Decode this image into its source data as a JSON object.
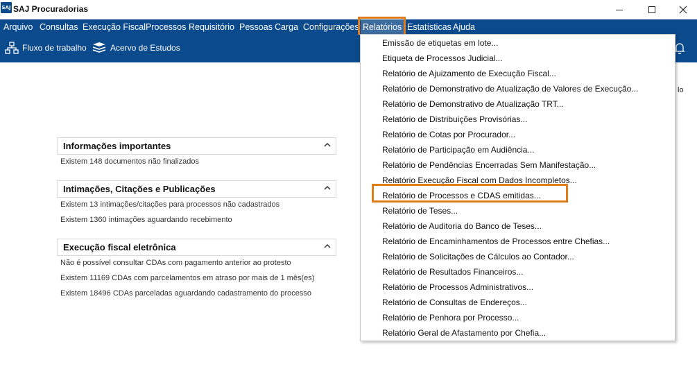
{
  "window": {
    "logo_text": "SAJ",
    "title": "SAJ Procuradorias"
  },
  "menubar": {
    "items": [
      "Arquivo",
      "Consultas",
      "Execução Fiscal",
      "Processos",
      "Requisitório",
      "Pessoas",
      "Carga",
      "Configurações",
      "Relatórios",
      "Estatísticas",
      "Ajuda"
    ]
  },
  "toolbar": {
    "workflow_label": "Fluxo de trabalho",
    "studies_label": "Acervo de Estudos"
  },
  "partial_right_label": "lo",
  "panels": [
    {
      "title": "Informações importantes",
      "rows": [
        "Existem  148 documentos não finalizados"
      ]
    },
    {
      "title": "Intimações, Citações e Publicações",
      "rows": [
        "Existem  13 intimações/citações para processos não cadastrados",
        "Existem  1360 intimações aguardando recebimento"
      ]
    },
    {
      "title": "Execução fiscal eletrônica",
      "rows": [
        "Não é possível consultar CDAs com pagamento anterior ao protesto",
        "Existem  11169 CDAs com parcelamentos em atraso por mais de 1 mês(es)",
        "Existem  18496 CDAs parceladas aguardando cadastramento do processo"
      ]
    }
  ],
  "dropdown": {
    "items": [
      "Emissão de etiquetas em lote...",
      "Etiqueta de Processos Judicial...",
      "Relatório de Ajuizamento de Execução Fiscal...",
      "Relatório de Demonstrativo de Atualização de Valores de Execução...",
      "Relatório de Demonstrativo de Atualização TRT...",
      "Relatório de Distribuições Provisórias...",
      "Relatório de Cotas por Procurador...",
      "Relatório de Participação em Audiência...",
      "Relatório de Pendências Encerradas Sem Manifestação...",
      "Relatório Execução Fiscal com Dados Incompletos...",
      "Relatório de Processos e CDAS emitidas...",
      "Relatório de Teses...",
      "Relatório de Auditoria do Banco de Teses...",
      "Relatório de Encaminhamentos de Processos entre Chefias...",
      "Relatório de Solicitações de Cálculos ao Contador...",
      "Relatório de Resultados Financeiros...",
      "Relatório de Processos Administrativos...",
      "Relatório de Consultas de Endereços...",
      "Relatório de Penhora por Processo...",
      "Relatório Geral de Afastamento por Chefia..."
    ],
    "highlighted_item": "Relatório de Processos e CDAS emitidas..."
  },
  "colors": {
    "menubar_bg": "#0b4a8c",
    "active_menu_bg": "#3d6da0",
    "highlight_outline": "#e07b1a"
  }
}
